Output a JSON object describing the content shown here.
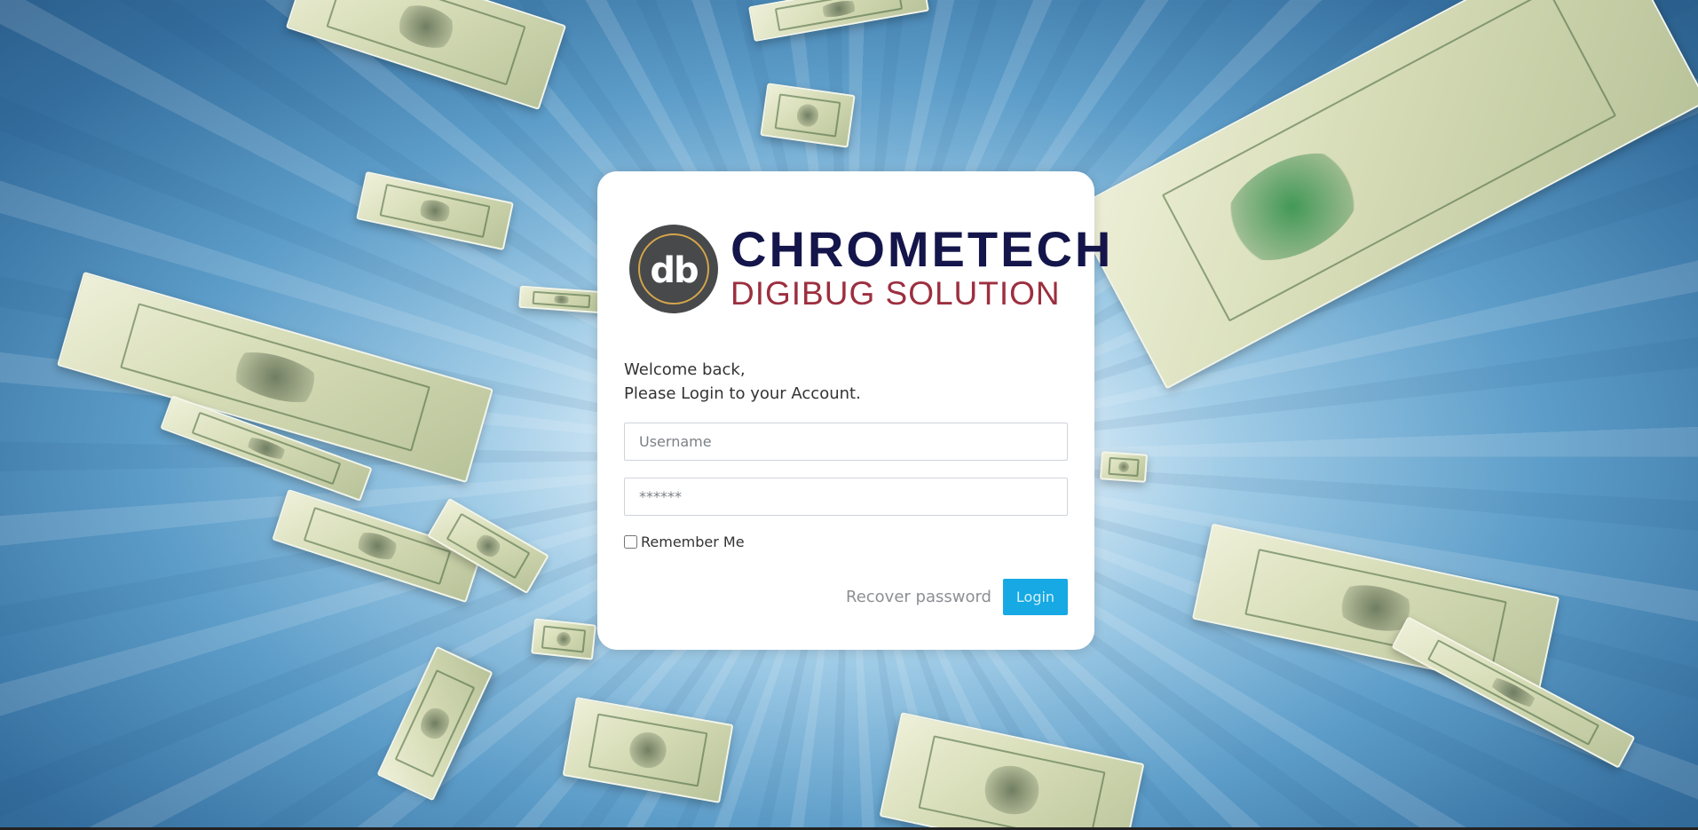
{
  "brand": {
    "monogram": "db",
    "title": "CHROMETECH",
    "subtitle": "DIGIBUG SOLUTION",
    "title_color": "#14154a",
    "subtitle_color": "#9c2f3f"
  },
  "login": {
    "welcome_line1": "Welcome back,",
    "welcome_line2": "Please Login to your Account.",
    "username_placeholder": "Username",
    "password_placeholder": "******",
    "remember_label": "Remember Me",
    "recover_link": "Recover password",
    "login_button": "Login",
    "accent_color": "#16a9e3"
  },
  "background": {
    "theme": "flying-hundred-dollar-bills",
    "sky_color": "#5d9dc9"
  }
}
